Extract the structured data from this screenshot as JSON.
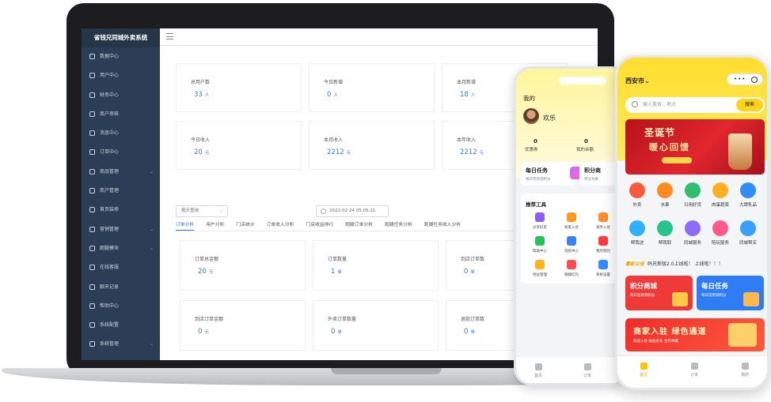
{
  "admin": {
    "app_title": "省钱兄同城外卖系统",
    "sidebar": [
      {
        "label": "数据中心",
        "has_children": false
      },
      {
        "label": "用户中心",
        "has_children": false
      },
      {
        "label": "财务中心",
        "has_children": false
      },
      {
        "label": "商户审核",
        "has_children": false
      },
      {
        "label": "消息中心",
        "has_children": false
      },
      {
        "label": "订单中心",
        "has_children": false
      },
      {
        "label": "商品管理",
        "has_children": true
      },
      {
        "label": "商户管理",
        "has_children": false
      },
      {
        "label": "首页装修",
        "has_children": false
      },
      {
        "label": "营销管理",
        "has_children": true
      },
      {
        "label": "跑腿模块",
        "has_children": true
      },
      {
        "label": "在线客服",
        "has_children": false
      },
      {
        "label": "聊天记录",
        "has_children": false
      },
      {
        "label": "帮助中心",
        "has_children": false
      },
      {
        "label": "系统配置",
        "has_children": false
      },
      {
        "label": "系统管理",
        "has_children": true
      }
    ],
    "stats": [
      {
        "label": "总用户数",
        "value": "33",
        "unit": "人"
      },
      {
        "label": "今日新增",
        "value": "0",
        "unit": "人"
      },
      {
        "label": "本月新增",
        "value": "18",
        "unit": "人"
      },
      {
        "label": "今日收入",
        "value": "20",
        "unit": "元"
      },
      {
        "label": "本月收入",
        "value": "2212",
        "unit": "元"
      },
      {
        "label": "本年收入",
        "value": "2212",
        "unit": "元"
      }
    ],
    "filter": {
      "mode": "按天查询",
      "date": "2022-02-24 05:05:21"
    },
    "tabs": [
      "订单分析",
      "用户分析",
      "门店统计",
      "订单收入分析",
      "门店收益排行",
      "跑腿订单分析",
      "跑腿任务分析",
      "跑腿任务收入分析"
    ],
    "active_tab": 0,
    "order_stats": [
      {
        "label": "订单总金额",
        "value": "20",
        "unit": "元"
      },
      {
        "label": "订单数量",
        "value": "1",
        "unit": "单"
      },
      {
        "label": "到店订单数",
        "value": "0",
        "unit": "单"
      },
      {
        "label": "到店订单金额",
        "value": "0",
        "unit": "元"
      },
      {
        "label": "外卖订单数量",
        "value": "0",
        "unit": "单"
      },
      {
        "label": "退款订单数",
        "value": "0",
        "unit": "单"
      }
    ]
  },
  "phone_profile": {
    "title": "我的",
    "username": "欢乐",
    "stats": [
      {
        "value": "0",
        "label": "优惠券"
      },
      {
        "value": "0",
        "label": "我的余额"
      }
    ],
    "task_card": {
      "title": "每日任务",
      "subtitle": "每日签到领积分"
    },
    "points_card": {
      "title": "积分商",
      "subtitle": "积分兑换"
    },
    "tools_title": "推荐工具",
    "tools": [
      {
        "label": "分享好友",
        "icon": "users-icon",
        "color": "#8e5cff"
      },
      {
        "label": "商家入驻",
        "icon": "shop-icon",
        "color": "#ff9a1f"
      },
      {
        "label": "骑手入驻",
        "icon": "rider-icon",
        "color": "#ff8b2a"
      },
      {
        "label": "帮助中心",
        "icon": "help-icon",
        "color": "#29c15a"
      },
      {
        "label": "消息中心",
        "icon": "message-icon",
        "color": "#3b82f6"
      },
      {
        "label": "我的钱包",
        "icon": "wallet-icon",
        "color": "#ff3b3b"
      },
      {
        "label": "地址管理",
        "icon": "location-icon",
        "color": "#ffb31a"
      },
      {
        "label": "跑腿红包",
        "icon": "redpacket-icon",
        "color": "#ff4d4f"
      },
      {
        "label": "系统设置",
        "icon": "gear-icon",
        "color": "#2f8cff"
      }
    ],
    "tabbar": [
      {
        "label": "首页",
        "icon": "home-icon"
      },
      {
        "label": "订单",
        "icon": "order-icon"
      }
    ]
  },
  "phone_home": {
    "city": "西安市",
    "search_placeholder": "输入美食、地点",
    "search_button": "搜索",
    "banner": {
      "title": "圣诞节",
      "subtitle": "暖心回馈"
    },
    "categories": [
      {
        "label": "外卖",
        "color": "#ff5a3d"
      },
      {
        "label": "水果",
        "color": "#ff8a1e"
      },
      {
        "label": "日用好货",
        "color": "#2fbf71"
      },
      {
        "label": "肉蛋蔬菜",
        "color": "#ffb021"
      },
      {
        "label": "大牌乳品",
        "color": "#2f8cff"
      },
      {
        "label": "帮我送",
        "color": "#2fb0ff"
      },
      {
        "label": "帮我取",
        "color": "#27c48b"
      },
      {
        "label": "同城服务",
        "color": "#8c6cff"
      },
      {
        "label": "陪玩服务",
        "color": "#ff5a8a"
      },
      {
        "label": "同城帮买",
        "color": "#3aa0ff"
      }
    ],
    "notice_tag": "最新公告",
    "notice_text": "码兄新版2.0上线啦！ 上线啦！！！",
    "promos": [
      {
        "title": "积分商城",
        "subtitle": "每日签到领积分",
        "color": "#f03a3a"
      },
      {
        "title": "每日任务",
        "subtitle": "每日签到领积分",
        "color": "#2f7df6"
      }
    ],
    "wide_banner": {
      "title": "商家入驻 绿色通道",
      "subtitle": "快速入驻 收益多多 合作共赢"
    },
    "tabbar": [
      {
        "label": "首页",
        "icon": "home-icon",
        "active": true
      },
      {
        "label": "订单",
        "icon": "order-icon",
        "active": false
      },
      {
        "label": "我的",
        "icon": "user-icon",
        "active": false
      }
    ]
  }
}
